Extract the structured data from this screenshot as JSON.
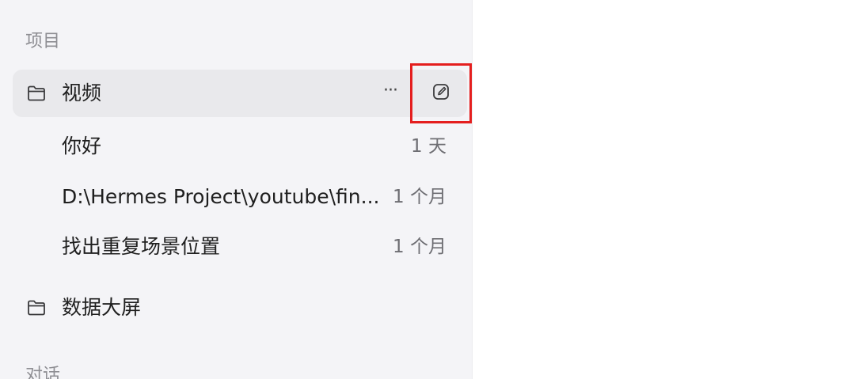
{
  "sidebar": {
    "projects_label": "项目",
    "projects": [
      {
        "name": "视频",
        "icon": "folder-icon",
        "more_label": "···",
        "edit_icon": "edit-pencil-icon",
        "conversations": [
          {
            "title": "你好",
            "time": "1 天"
          },
          {
            "title": "D:\\Hermes Project\\youtube\\fin...",
            "time": "1 个月"
          },
          {
            "title": "找出重复场景位置",
            "time": "1 个月"
          }
        ]
      },
      {
        "name": "数据大屏",
        "icon": "folder-icon"
      }
    ],
    "chats_label": "对话"
  },
  "colors": {
    "sidebar_bg": "#f4f4f7",
    "active_row_bg": "#e9e9ec",
    "highlight_box": "#e41e1e"
  }
}
